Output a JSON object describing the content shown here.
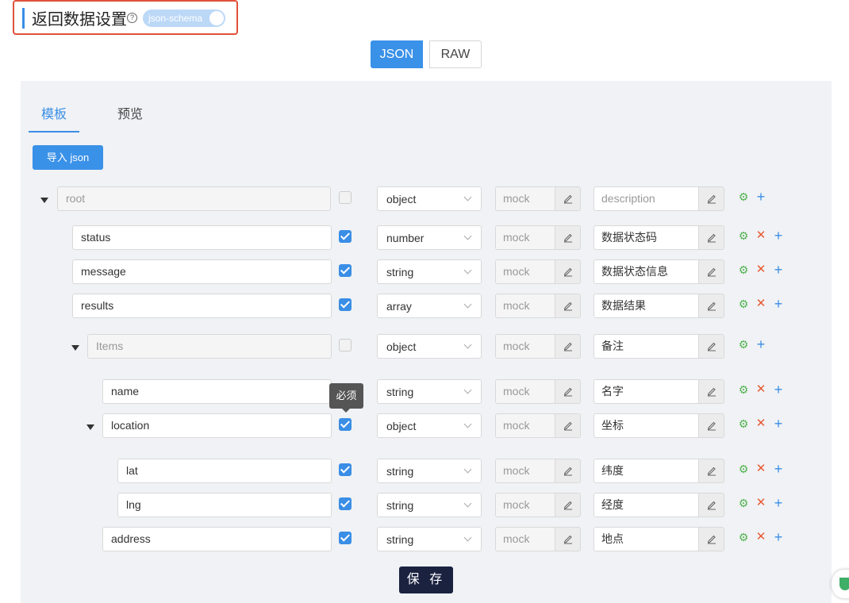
{
  "header": {
    "title": "返回数据设置",
    "help_glyph": "?",
    "toggle_label": "json-schema"
  },
  "mode_tabs": {
    "json": "JSON",
    "raw": "RAW"
  },
  "tabs": {
    "template": "模板",
    "preview": "预览"
  },
  "import_button": "导入 json",
  "rows": [
    {
      "name": "root",
      "type": "object",
      "mock": "mock",
      "desc": "description",
      "required": false,
      "disabled": true,
      "can_delete": false
    },
    {
      "name": "status",
      "type": "number",
      "mock": "mock",
      "desc": "数据状态码",
      "required": true,
      "disabled": false,
      "can_delete": true
    },
    {
      "name": "message",
      "type": "string",
      "mock": "mock",
      "desc": "数据状态信息",
      "required": true,
      "disabled": false,
      "can_delete": true
    },
    {
      "name": "results",
      "type": "array",
      "mock": "mock",
      "desc": "数据结果",
      "required": true,
      "disabled": false,
      "can_delete": true
    },
    {
      "name": "Items",
      "type": "object",
      "mock": "mock",
      "desc": "备注",
      "required": false,
      "disabled": true,
      "can_delete": false
    },
    {
      "name": "name",
      "type": "string",
      "mock": "mock",
      "desc": "名字",
      "required": true,
      "disabled": false,
      "can_delete": true
    },
    {
      "name": "location",
      "type": "object",
      "mock": "mock",
      "desc": "坐标",
      "required": true,
      "disabled": false,
      "can_delete": true
    },
    {
      "name": "lat",
      "type": "string",
      "mock": "mock",
      "desc": "纬度",
      "required": true,
      "disabled": false,
      "can_delete": true
    },
    {
      "name": "lng",
      "type": "string",
      "mock": "mock",
      "desc": "经度",
      "required": true,
      "disabled": false,
      "can_delete": true
    },
    {
      "name": "address",
      "type": "string",
      "mock": "mock",
      "desc": "地点",
      "required": true,
      "disabled": false,
      "can_delete": true
    }
  ],
  "tooltip": "必须",
  "save_button": "保 存",
  "colors": {
    "accent": "#3a8ee6",
    "highlight_border": "#e0503a",
    "save_button": "#1b2240",
    "add": "#3a8ee6",
    "delete": "#e85a33",
    "settings": "#52b24f"
  }
}
